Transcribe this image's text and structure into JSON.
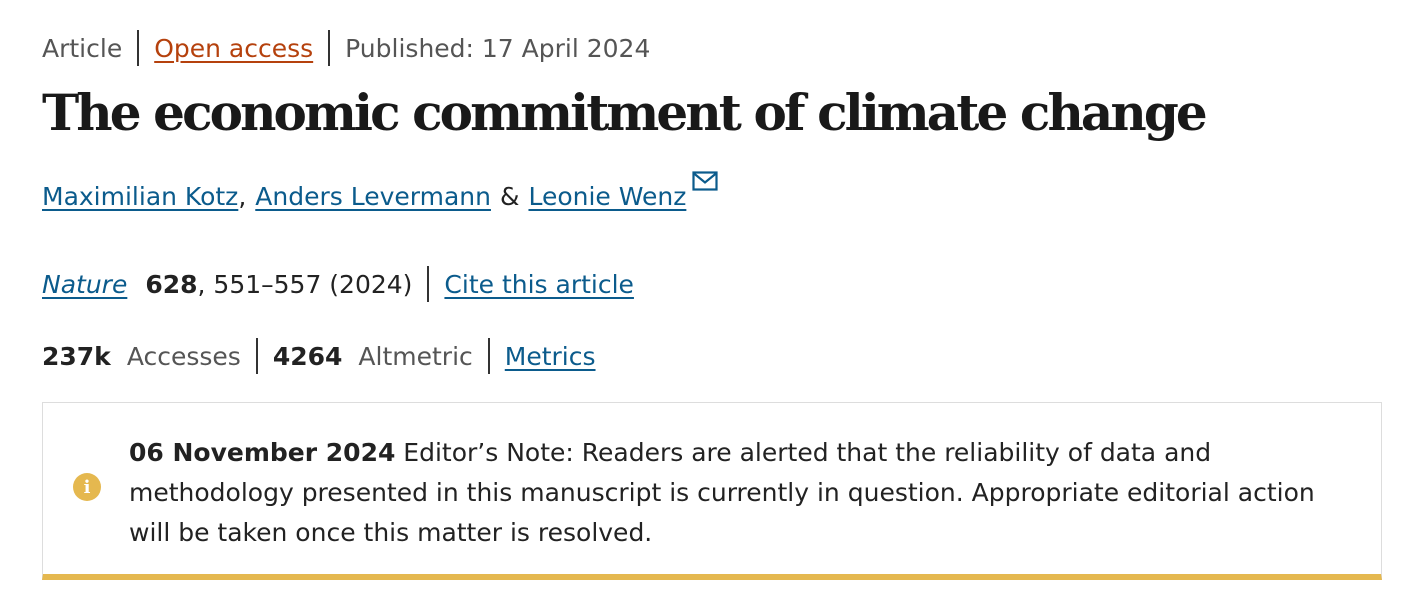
{
  "meta": {
    "type": "Article",
    "access": "Open access",
    "published": "Published: 17 April 2024"
  },
  "title": "The economic commitment of climate change",
  "authors": {
    "author1": "Maximilian Kotz",
    "comma": ",",
    "author2": "Anders Levermann",
    "amp": "&",
    "author3": "Leonie Wenz",
    "icon": "mail-icon"
  },
  "journal": {
    "name": "Nature",
    "volume": "628",
    "pages_year": ", 551–557 (2024)",
    "cite": "Cite this article"
  },
  "metrics": {
    "accesses_value": "237k",
    "accesses_label": "Accesses",
    "altmetric_value": "4264",
    "altmetric_label": "Altmetric",
    "metrics_link": "Metrics"
  },
  "editor_note": {
    "icon": "info-icon",
    "date": "06 November 2024",
    "text": " Editor’s Note: Readers are alerted that the reliability of data and methodology presented in this manuscript is currently in question. Appropriate editorial action will be taken once this matter is resolved.",
    "accent_color": "#e5b84f"
  }
}
